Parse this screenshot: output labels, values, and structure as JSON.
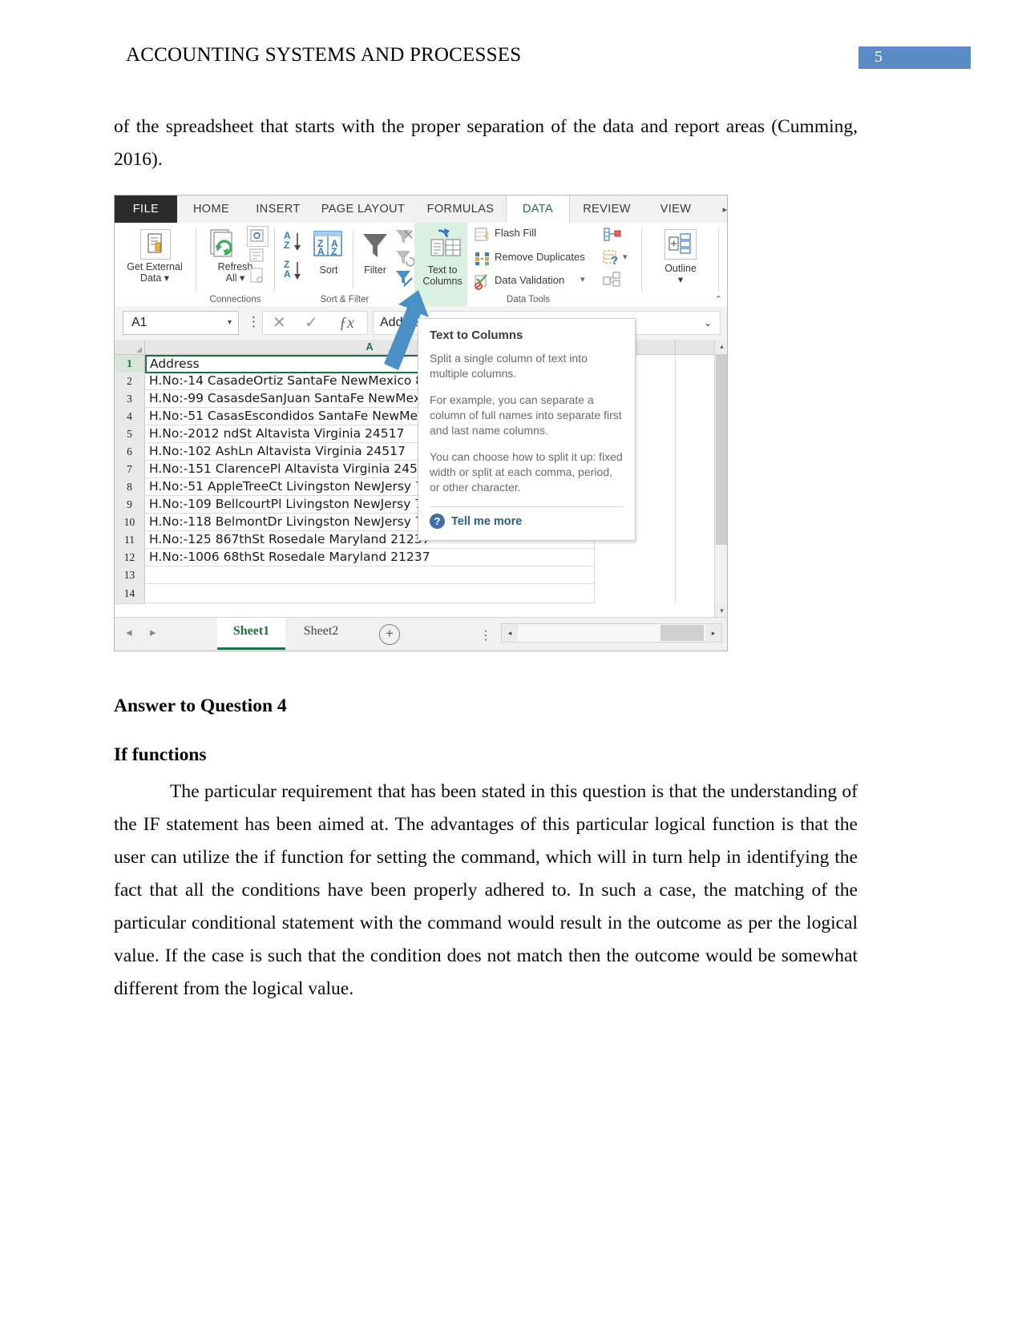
{
  "document": {
    "running_head": "ACCOUNTING SYSTEMS AND PROCESSES",
    "page_number": "5",
    "intro_paragraph": "of the spreadsheet that starts with the proper separation of the data and report areas (Cumming, 2016).",
    "heading_answer": "Answer to Question 4",
    "heading_subsection": "If functions",
    "if_paragraph": "The particular requirement that has been stated in this question is that the understanding of the IF statement has been aimed at. The advantages of this particular logical function is that the user can utilize the if function for setting the command, which will in turn help in identifying the fact that all the conditions have been properly adhered to. In such a case, the matching of the particular conditional statement with the command would result in the outcome as per the logical value. If the case is such that the condition does not match then the outcome would be somewhat different from the logical value.",
    "accent_color": "#5b8bc4"
  },
  "excel": {
    "ribbon_tabs": [
      {
        "label": "FILE",
        "active": false
      },
      {
        "label": "HOME",
        "active": false
      },
      {
        "label": "INSERT",
        "active": false
      },
      {
        "label": "PAGE LAYOUT",
        "active": false
      },
      {
        "label": "FORMULAS",
        "active": false
      },
      {
        "label": "DATA",
        "active": true
      },
      {
        "label": "REVIEW",
        "active": false
      },
      {
        "label": "VIEW",
        "active": false
      }
    ],
    "tab_overflow_glyph": "▸",
    "groups": {
      "get_external_data": {
        "line1": "Get External",
        "line2": "Data ▾",
        "label": ""
      },
      "connections": {
        "refresh1": "Refresh",
        "refresh2": "All ▾",
        "label": "Connections"
      },
      "sort_filter": {
        "sort": "Sort",
        "filter": "Filter",
        "label": "Sort & Filter"
      },
      "data_tools": {
        "text_to_columns_1": "Text to",
        "text_to_columns_2": "Columns",
        "flash_fill": "Flash Fill",
        "remove_duplicates": "Remove Duplicates",
        "data_validation": "Data Validation",
        "data_validation_caret": "▾",
        "label": "Data Tools"
      },
      "outline": {
        "label_btn": "Outline",
        "caret": "▾"
      }
    },
    "ribbon_collapse_caret": "⌃",
    "name_box": {
      "value": "A1",
      "caret": "▾"
    },
    "formula_bar": {
      "cancel_icon": "✕",
      "enter_icon": "✓",
      "fx_icon": "ƒx",
      "value": "Address",
      "dropdown_caret": "⌄",
      "vertical_dots": "⋮"
    },
    "column_headers": [
      "A",
      "",
      ""
    ],
    "rows": [
      {
        "num": "1",
        "a": "Address"
      },
      {
        "num": "2",
        "a": "H.No:-14 CasadeOrtiz SantaFe NewMexico 87501"
      },
      {
        "num": "3",
        "a": "H.No:-99 CasasdeSanJuan SantaFe NewMexico 87501"
      },
      {
        "num": "4",
        "a": "H.No:-51 CasasEscondidos SantaFe NewMexico 87501"
      },
      {
        "num": "5",
        "a": "H.No:-2012 ndSt Altavista Virginia 24517"
      },
      {
        "num": "6",
        "a": "H.No:-102 AshLn Altavista Virginia 24517"
      },
      {
        "num": "7",
        "a": "H.No:-151 ClarencePl Altavista Virginia 24517"
      },
      {
        "num": "8",
        "a": "H.No:-51 AppleTreeCt Livingston NewJersy 7039"
      },
      {
        "num": "9",
        "a": "H.No:-109 BellcourtPl Livingston NewJersy 7039"
      },
      {
        "num": "10",
        "a": "H.No:-118 BelmontDr Livingston NewJersy 7039"
      },
      {
        "num": "11",
        "a": "H.No:-125 867thSt Rosedale Maryland 21237"
      },
      {
        "num": "12",
        "a": "H.No:-1006 68thSt Rosedale Maryland 21237"
      },
      {
        "num": "13",
        "a": ""
      },
      {
        "num": "14",
        "a": ""
      }
    ],
    "sheet_tabs": [
      {
        "label": "Sheet1",
        "active": true
      },
      {
        "label": "Sheet2",
        "active": false
      }
    ],
    "sheet_add_glyph": "+",
    "sheet_nav_prev": "◂",
    "sheet_nav_next": "▸",
    "sheet_options_dots": "⋮",
    "hscroll_left": "◂",
    "hscroll_right": "▸",
    "vscroll_up": "▴",
    "vscroll_down": "▾"
  },
  "tooltip": {
    "title": "Text to Columns",
    "paragraphs": [
      "Split a single column of text into multiple columns.",
      "For example, you can separate a column of full names into separate first and last name columns.",
      "You can choose how to split it up: fixed width or split at each comma, period, or other character."
    ],
    "help_icon": "?",
    "help_label": "Tell me more",
    "help_color": "#2e5c8a"
  }
}
